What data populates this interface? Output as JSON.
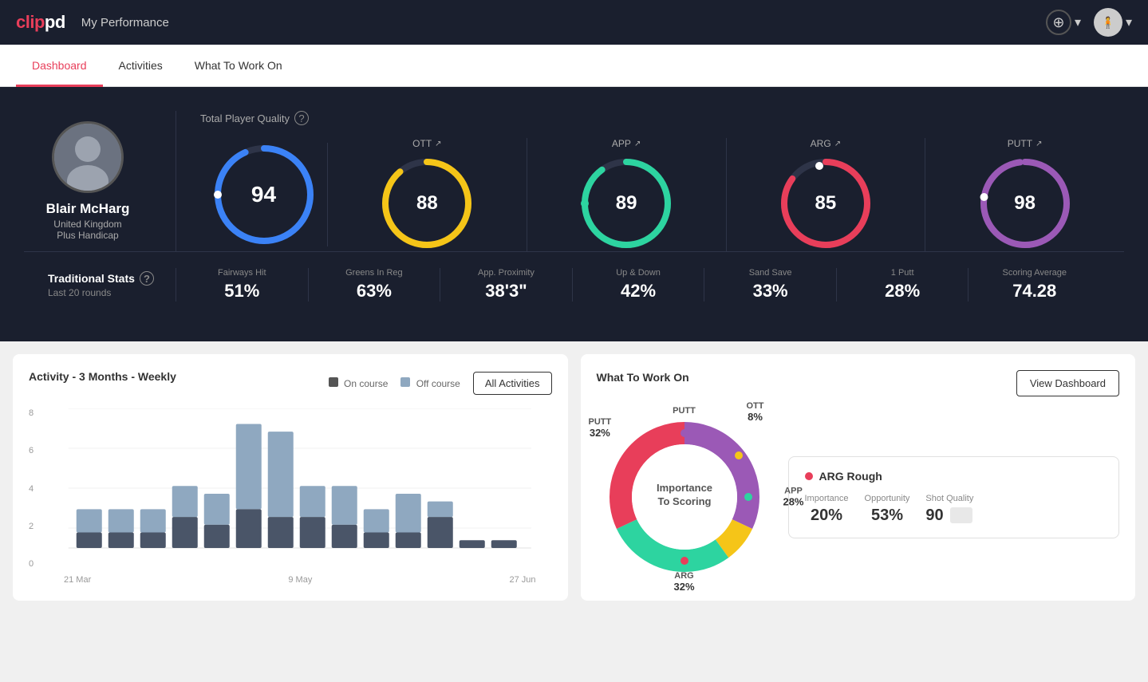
{
  "app": {
    "logo": "clippd",
    "logo_color_part": "clip",
    "logo_white_part": "pd"
  },
  "header": {
    "title": "My Performance",
    "nav_add_label": "+",
    "nav_dropdown_label": "▾"
  },
  "tabs": [
    {
      "label": "Dashboard",
      "active": true
    },
    {
      "label": "Activities",
      "active": false
    },
    {
      "label": "What To Work On",
      "active": false
    }
  ],
  "profile": {
    "name": "Blair McHarg",
    "country": "United Kingdom",
    "handicap": "Plus Handicap"
  },
  "quality": {
    "title": "Total Player Quality",
    "main_score": 94,
    "categories": [
      {
        "label": "OTT",
        "score": 88,
        "color": "#f5c518"
      },
      {
        "label": "APP",
        "score": 89,
        "color": "#2dd4a0"
      },
      {
        "label": "ARG",
        "score": 85,
        "color": "#e83e5a"
      },
      {
        "label": "PUTT",
        "score": 98,
        "color": "#9b59b6"
      }
    ]
  },
  "traditional_stats": {
    "title": "Traditional Stats",
    "subtitle": "Last 20 rounds",
    "stats": [
      {
        "label": "Fairways Hit",
        "value": "51%"
      },
      {
        "label": "Greens In Reg",
        "value": "63%"
      },
      {
        "label": "App. Proximity",
        "value": "38'3\""
      },
      {
        "label": "Up & Down",
        "value": "42%"
      },
      {
        "label": "Sand Save",
        "value": "33%"
      },
      {
        "label": "1 Putt",
        "value": "28%"
      },
      {
        "label": "Scoring Average",
        "value": "74.28"
      }
    ]
  },
  "activity_chart": {
    "title": "Activity - 3 Months - Weekly",
    "legend_on_course": "On course",
    "legend_off_course": "Off course",
    "all_activities_btn": "All Activities",
    "x_labels": [
      "21 Mar",
      "9 May",
      "27 Jun"
    ],
    "y_labels": [
      "8",
      "6",
      "4",
      "2",
      "0"
    ],
    "bars": [
      {
        "on": 1,
        "off": 1.5
      },
      {
        "on": 1,
        "off": 1.5
      },
      {
        "on": 1,
        "off": 1.5
      },
      {
        "on": 2,
        "off": 2
      },
      {
        "on": 1.5,
        "off": 2
      },
      {
        "on": 2.5,
        "off": 5.5
      },
      {
        "on": 2,
        "off": 5.5
      },
      {
        "on": 2,
        "off": 2
      },
      {
        "on": 1.5,
        "off": 2.5
      },
      {
        "on": 1,
        "off": 1.5
      },
      {
        "on": 1,
        "off": 2.5
      },
      {
        "on": 2,
        "off": 1
      },
      {
        "on": 0.5,
        "off": 0
      },
      {
        "on": 0.5,
        "off": 0
      }
    ]
  },
  "what_to_work_on": {
    "title": "What To Work On",
    "view_dashboard_btn": "View Dashboard",
    "donut_center": "Importance\nTo Scoring",
    "segments": [
      {
        "label": "OTT",
        "value": "8%",
        "color": "#f5c518"
      },
      {
        "label": "APP",
        "value": "28%",
        "color": "#2dd4a0"
      },
      {
        "label": "ARG",
        "value": "32%",
        "color": "#e83e5a"
      },
      {
        "label": "PUTT",
        "value": "32%",
        "color": "#9b59b6"
      }
    ],
    "card": {
      "title": "ARG Rough",
      "dot_color": "#e83e5a",
      "metrics": [
        {
          "label": "Importance",
          "value": "20%"
        },
        {
          "label": "Opportunity",
          "value": "53%"
        },
        {
          "label": "Shot Quality",
          "value": "90"
        }
      ]
    }
  }
}
